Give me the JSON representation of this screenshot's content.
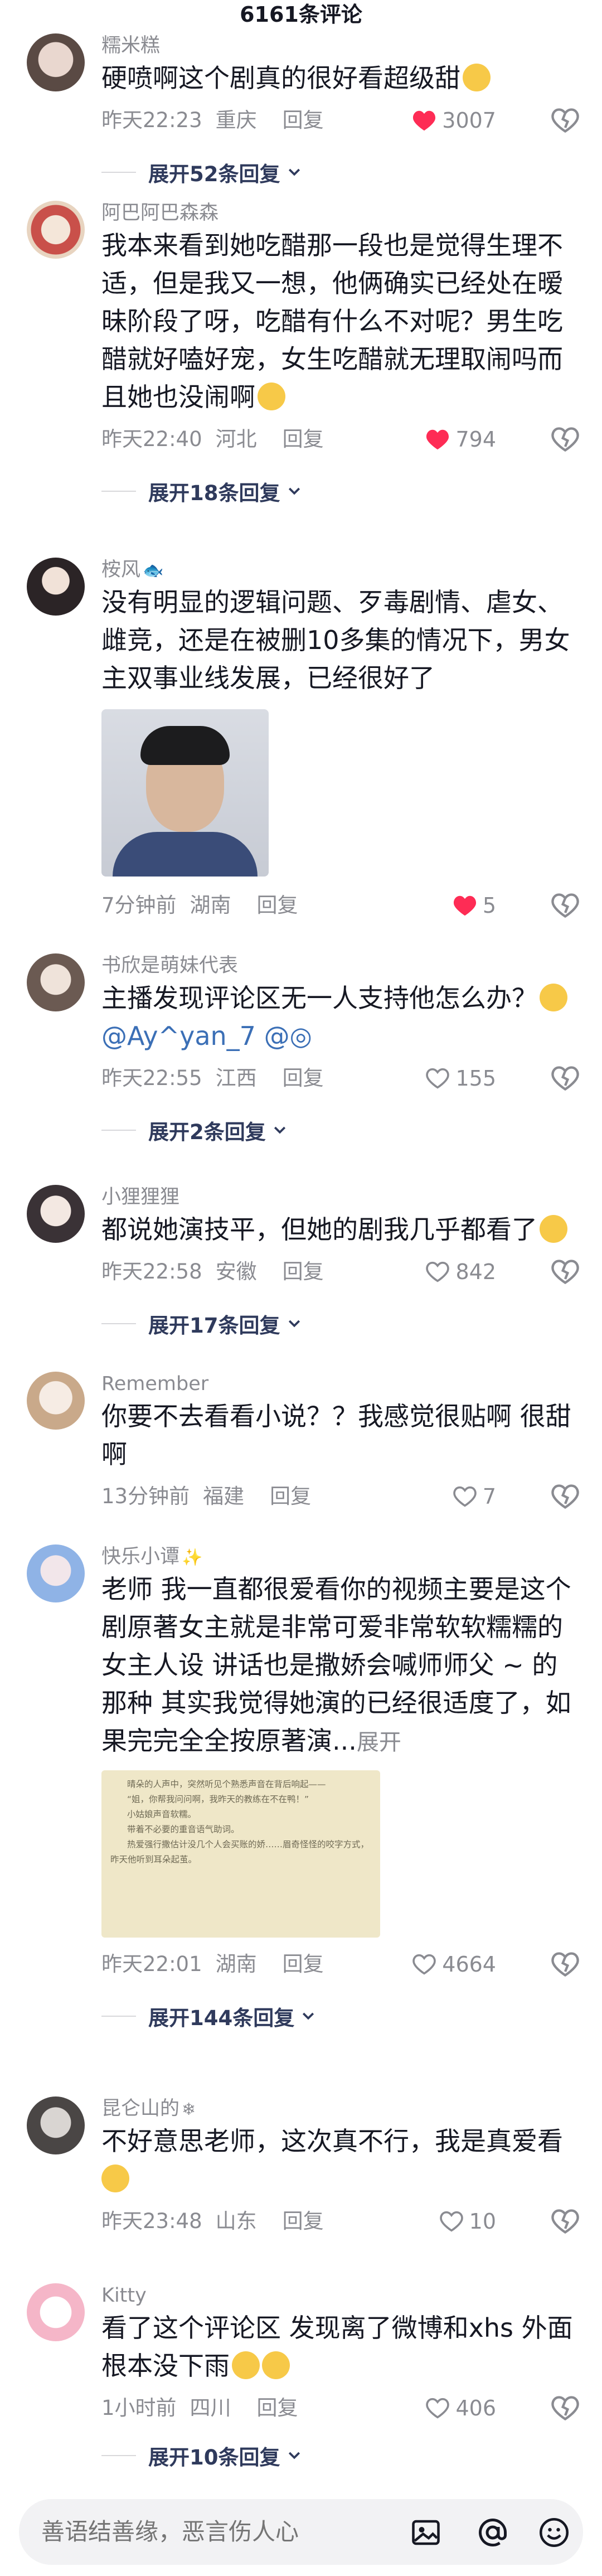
{
  "header": {
    "title": "6161条评论"
  },
  "comments": [
    {
      "user": "糯米糕",
      "text": "硬喷啊这个剧真的很好看超级甜",
      "time": "昨天22:23",
      "loc": "重庆",
      "reply": "回复",
      "likes": "3007",
      "liked": true,
      "replies": "展开52条回复"
    },
    {
      "user": "阿巴阿巴森森",
      "text": "我本来看到她吃醋那一段也是觉得生理不适，但是我又一想，他俩确实已经处在暧昧阶段了呀，吃醋有什么不对呢？男生吃醋就好嗑好宠，女生吃醋就无理取闹吗而且她也没闹啊",
      "time": "昨天22:40",
      "loc": "河北",
      "reply": "回复",
      "likes": "794",
      "liked": true,
      "replies": "展开18条回复"
    },
    {
      "user": "桉风",
      "text": "没有明显的逻辑问题、歹毒剧情、虐女、雌竞，还是在被删10多集的情况下，男女主双事业线发展，已经很好了",
      "time": "7分钟前",
      "loc": "湖南",
      "reply": "回复",
      "likes": "5",
      "liked": true
    },
    {
      "user": "书欣是萌妹代表",
      "text": "主播发现评论区无一人支持他怎么办？",
      "mention": "@Ay^yan_7 @",
      "time": "昨天22:55",
      "loc": "江西",
      "reply": "回复",
      "likes": "155",
      "liked": false,
      "replies": "展开2条回复"
    },
    {
      "user": "小狸狸狸",
      "text": "都说她演技平，但她的剧我几乎都看了",
      "time": "昨天22:58",
      "loc": "安徽",
      "reply": "回复",
      "likes": "842",
      "liked": false,
      "replies": "展开17条回复"
    },
    {
      "user": "Remember",
      "text": "你要不去看看小说？？我感觉很贴啊 很甜啊",
      "time": "13分钟前",
      "loc": "福建",
      "reply": "回复",
      "likes": "7",
      "liked": false
    },
    {
      "user": "快乐小谭",
      "text": "老师 我一直都很爱看你的视频主要是这个剧原著女主就是非常可爱非常软软糯糯的女主人设 讲话也是撒娇会喊师师父 ~ 的那种 其实我觉得她演的已经很适度了，如果完完全全按原著演...",
      "expand": "展开",
      "novel": [
        "晴朵的人声中，突然听见个熟悉声音在背后响起——",
        "“姐，你帮我问问啊，我昨天的教练在不在鸭！”",
        "小姑娘声音软糯。",
        "带着不必要的重音语气助词。",
        "热爱强行撒估计没几个人会买账的娇……眉奇怪怪的咬字方式，昨天他听到耳朵起茧。"
      ],
      "time": "昨天22:01",
      "loc": "湖南",
      "reply": "回复",
      "likes": "4664",
      "liked": false,
      "replies": "展开144条回复"
    },
    {
      "user": "昆仑山的",
      "text": "不好意思老师，这次真不行，我是真爱看",
      "time": "昨天23:48",
      "loc": "山东",
      "reply": "回复",
      "likes": "10",
      "liked": false
    },
    {
      "user": "Kitty",
      "text": "看了这个评论区 发现离了微博和xhs 外面根本没下雨",
      "time": "1小时前",
      "loc": "四川",
      "reply": "回复",
      "likes": "406",
      "liked": false,
      "replies": "展开10条回复"
    }
  ],
  "footer": {
    "placeholder": "善语结善缘，恶言伤人心"
  },
  "colors": {
    "like": "#fe2c55",
    "mention": "#3b6fb6",
    "expand_link": "#2f3a5c"
  }
}
